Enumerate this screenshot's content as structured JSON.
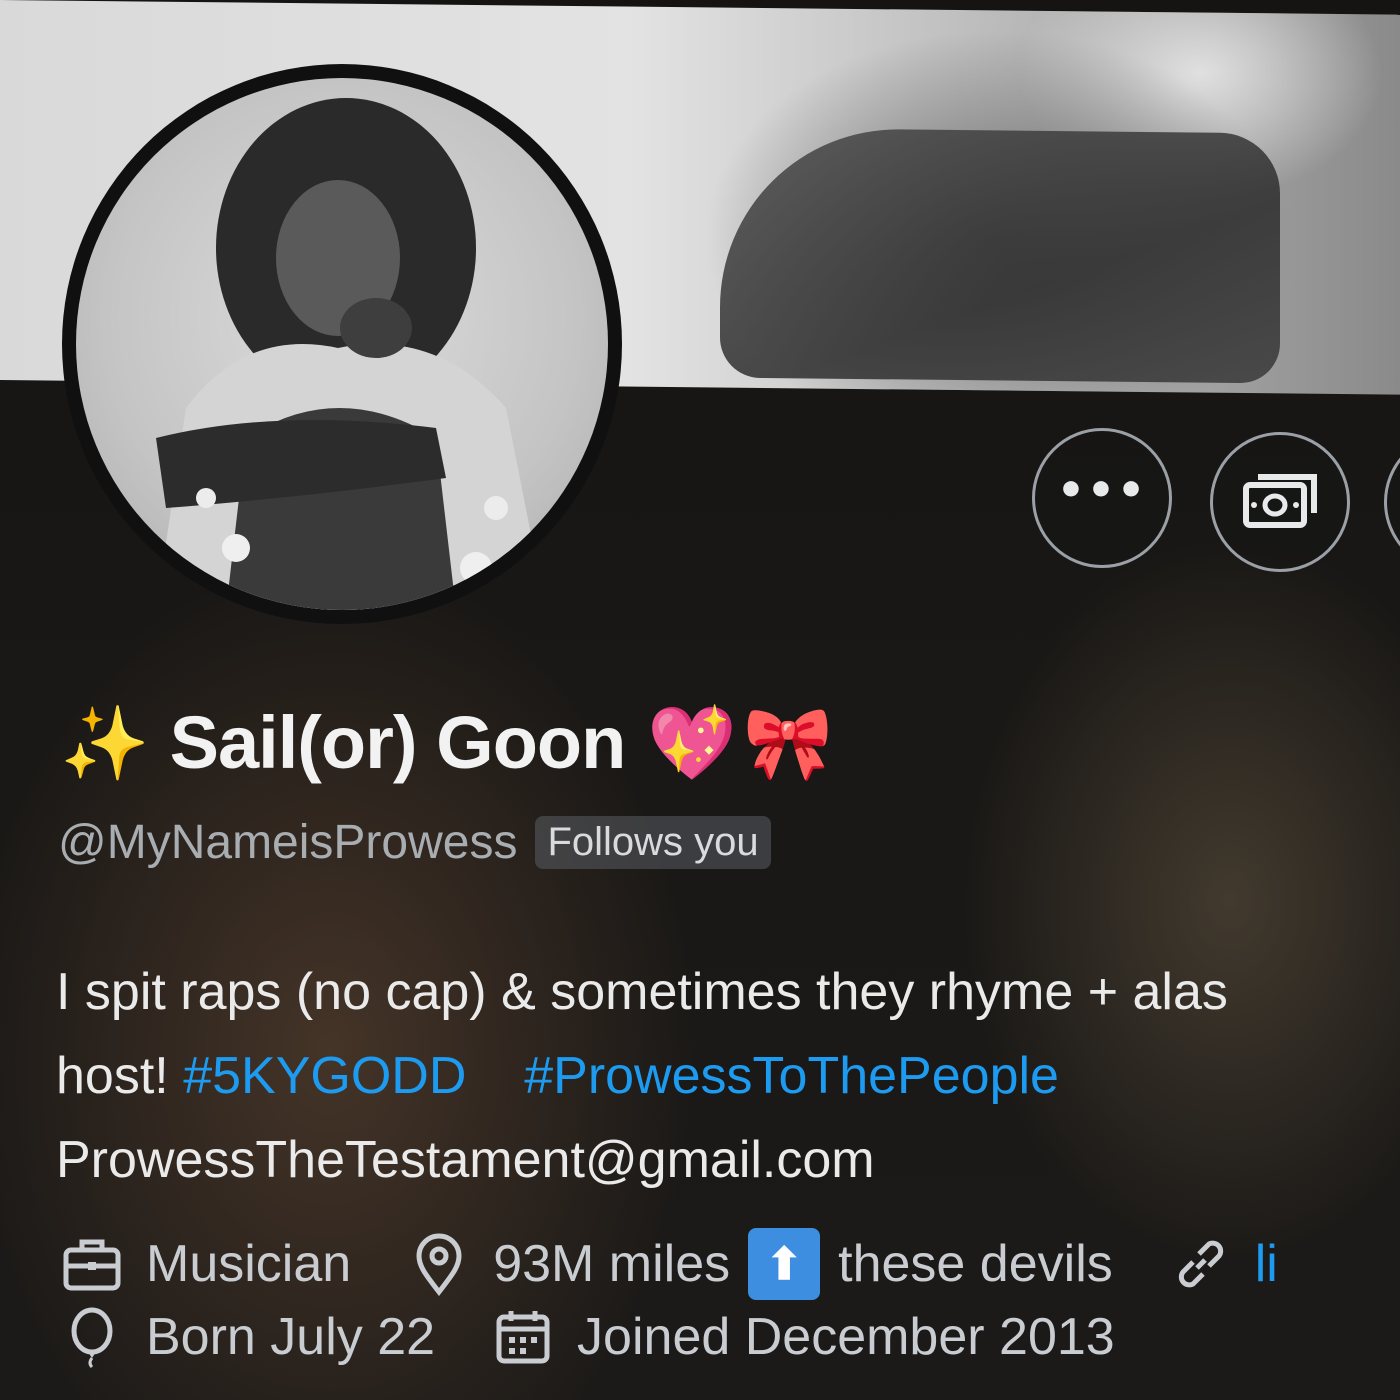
{
  "profile": {
    "name_emoji_left": "✨",
    "display_name": "Sail(or) Goon",
    "name_emoji_heart": "💖",
    "name_emoji_bow": "🎀",
    "handle": "@MyNameisProwess",
    "follows_you": "Follows you"
  },
  "bio": {
    "line1": "I spit raps (no cap) & sometimes they rhyme + alas",
    "line2_prefix": "host! ",
    "hashtag1": "#5KYGODD",
    "hashtag2": "#ProwessToThePeople",
    "line3": "ProwessTheTestament@gmail.com"
  },
  "meta": {
    "profession": "Musician",
    "location_prefix": "93M miles",
    "location_emoji": "⬆",
    "location_suffix": "these devils",
    "link_partial": "li",
    "birthday": "Born July 22",
    "joined": "Joined December 2013"
  },
  "buttons": {
    "more_glyph": "•••"
  },
  "colors": {
    "accent": "#1d9bf0",
    "text_primary": "#eaeaea",
    "text_secondary": "#a8adb2",
    "background": "#151412"
  },
  "icons": [
    "briefcase-icon",
    "location-pin-icon",
    "link-icon",
    "balloon-icon",
    "calendar-icon",
    "more-icon",
    "tip-jar-icon"
  ]
}
